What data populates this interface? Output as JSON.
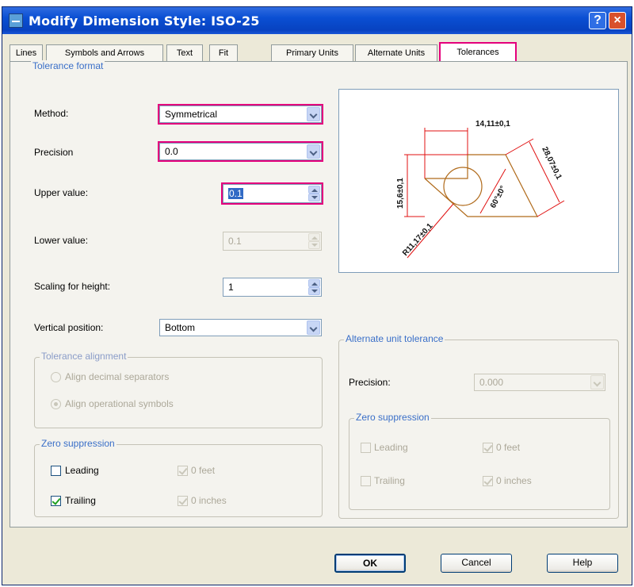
{
  "window": {
    "title": "Modify Dimension Style: ISO-25",
    "help_glyph": "?",
    "close_glyph": "×"
  },
  "tabs": [
    {
      "label": "Lines"
    },
    {
      "label": "Symbols and Arrows"
    },
    {
      "label": "Text"
    },
    {
      "label": "Fit"
    },
    {
      "label": "Primary Units"
    },
    {
      "label": "Alternate Units"
    },
    {
      "label": "Tolerances",
      "active": true
    }
  ],
  "tolerance_format": {
    "title": "Tolerance format",
    "method_label": "Method:",
    "method_value": "Symmetrical",
    "precision_label": "Precision",
    "precision_value": "0.0",
    "upper_label": "Upper value:",
    "upper_value": "0.1",
    "lower_label": "Lower value:",
    "lower_value": "0.1",
    "scaling_label": "Scaling for height:",
    "scaling_value": "1",
    "vertical_label": "Vertical position:",
    "vertical_value": "Bottom"
  },
  "tolerance_alignment": {
    "title": "Tolerance alignment",
    "align_decimal": "Align decimal separators",
    "align_operational": "Align operational symbols"
  },
  "zero_suppression": {
    "title": "Zero suppression",
    "leading": "Leading",
    "trailing": "Trailing",
    "feet": "0 feet",
    "inches": "0 inches"
  },
  "preview": {
    "dim_top": "14,11±0,1",
    "dim_left": "15,6±0,1",
    "dim_right": "28,07±0,1",
    "dim_angle": "60°±0°",
    "dim_radius": "R11,17±0,1"
  },
  "alternate_unit_tolerance": {
    "title": "Alternate unit tolerance",
    "precision_label": "Precision:",
    "precision_value": "0.000",
    "zero_title": "Zero suppression",
    "leading": "Leading",
    "trailing": "Trailing",
    "feet": "0 feet",
    "inches": "0 inches"
  },
  "buttons": {
    "ok": "OK",
    "cancel": "Cancel",
    "help": "Help"
  },
  "colors": {
    "highlight": "#e4007c",
    "title_bar": "#0a4fd3"
  }
}
